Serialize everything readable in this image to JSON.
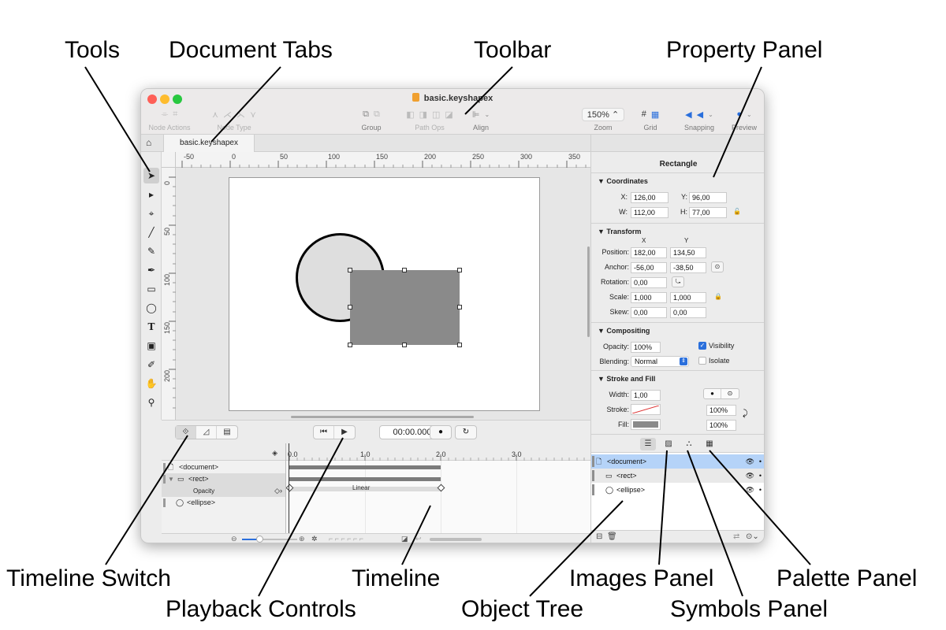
{
  "callouts": {
    "tools": "Tools",
    "document_tabs": "Document Tabs",
    "toolbar": "Toolbar",
    "property_panel": "Property Panel",
    "timeline_switch": "Timeline Switch",
    "playback_controls": "Playback Controls",
    "timeline": "Timeline",
    "object_tree": "Object Tree",
    "images_panel": "Images Panel",
    "symbols_panel": "Symbols Panel",
    "palette_panel": "Palette Panel"
  },
  "window": {
    "title": "basic.keyshapex"
  },
  "toolbar": {
    "node_actions_label": "Node Actions",
    "node_type_label": "Node Type",
    "group_label": "Group",
    "path_ops_label": "Path Ops",
    "align_label": "Align",
    "zoom_value": "150%",
    "zoom_label": "Zoom",
    "grid_label": "Grid",
    "snapping_label": "Snapping",
    "preview_label": "Preview"
  },
  "tabs": {
    "doc_tab": "basic.keyshapex"
  },
  "tools": [
    {
      "icon": "select-arrow-icon",
      "glyph": "➤"
    },
    {
      "icon": "node-select-icon",
      "glyph": "▸"
    },
    {
      "icon": "anchor-point-icon",
      "glyph": "⌖"
    },
    {
      "icon": "line-icon",
      "glyph": "╱"
    },
    {
      "icon": "pencil-icon",
      "glyph": "✎"
    },
    {
      "icon": "pen-icon",
      "glyph": "✒"
    },
    {
      "icon": "rectangle-icon",
      "glyph": "▭"
    },
    {
      "icon": "ellipse-icon",
      "glyph": "◯"
    },
    {
      "icon": "text-icon",
      "glyph": "T"
    },
    {
      "icon": "image-icon",
      "glyph": "▣"
    },
    {
      "icon": "eyedropper-icon",
      "glyph": "✐"
    },
    {
      "icon": "hand-icon",
      "glyph": "✋"
    },
    {
      "icon": "magnifier-icon",
      "glyph": "⚲"
    }
  ],
  "ruler_h": [
    "-50",
    "0",
    "50",
    "100",
    "150",
    "200",
    "250",
    "300",
    "350"
  ],
  "ruler_v": [
    "0",
    "50",
    "100",
    "150",
    "200"
  ],
  "playback": {
    "time": "00:00.000"
  },
  "timeline": {
    "ticks": [
      "0.0",
      "1.0",
      "2.0",
      "3.0"
    ],
    "rows": [
      {
        "label": "<document>"
      },
      {
        "label": "<rect>"
      },
      {
        "label": "Opacity"
      },
      {
        "label": "<ellipse>"
      }
    ],
    "linear_label": "Linear"
  },
  "properties": {
    "title": "Rectangle",
    "coordinates": {
      "section": "Coordinates",
      "x_label": "X:",
      "x": "126,00",
      "y_label": "Y:",
      "y": "96,00",
      "w_label": "W:",
      "w": "112,00",
      "h_label": "H:",
      "h": "77,00"
    },
    "transform": {
      "section": "Transform",
      "col_x": "X",
      "col_y": "Y",
      "position_label": "Position:",
      "position_x": "182,00",
      "position_y": "134,50",
      "anchor_label": "Anchor:",
      "anchor_x": "-56,00",
      "anchor_y": "-38,50",
      "rotation_label": "Rotation:",
      "rotation": "0,00",
      "scale_label": "Scale:",
      "scale_x": "1,000",
      "scale_y": "1,000",
      "skew_label": "Skew:",
      "skew_x": "0,00",
      "skew_y": "0,00"
    },
    "compositing": {
      "section": "Compositing",
      "opacity_label": "Opacity:",
      "opacity": "100%",
      "visibility_label": "Visibility",
      "blending_label": "Blending:",
      "blending": "Normal",
      "isolate_label": "Isolate"
    },
    "stroke_fill": {
      "section": "Stroke and Fill",
      "width_label": "Width:",
      "width": "1,00",
      "stroke_label": "Stroke:",
      "stroke_opacity": "100%",
      "fill_label": "Fill:",
      "fill_opacity": "100%",
      "fill_color": "#8a8a8a"
    }
  },
  "object_tree": {
    "rows": [
      {
        "label": "<document>"
      },
      {
        "label": "<rect>"
      },
      {
        "label": "<ellipse>"
      }
    ]
  },
  "colors": {
    "accent": "#2a6fdc",
    "selection": "#b5d3f8",
    "rect_fill": "#8a8a8a",
    "ellipse_fill": "#dedede"
  }
}
